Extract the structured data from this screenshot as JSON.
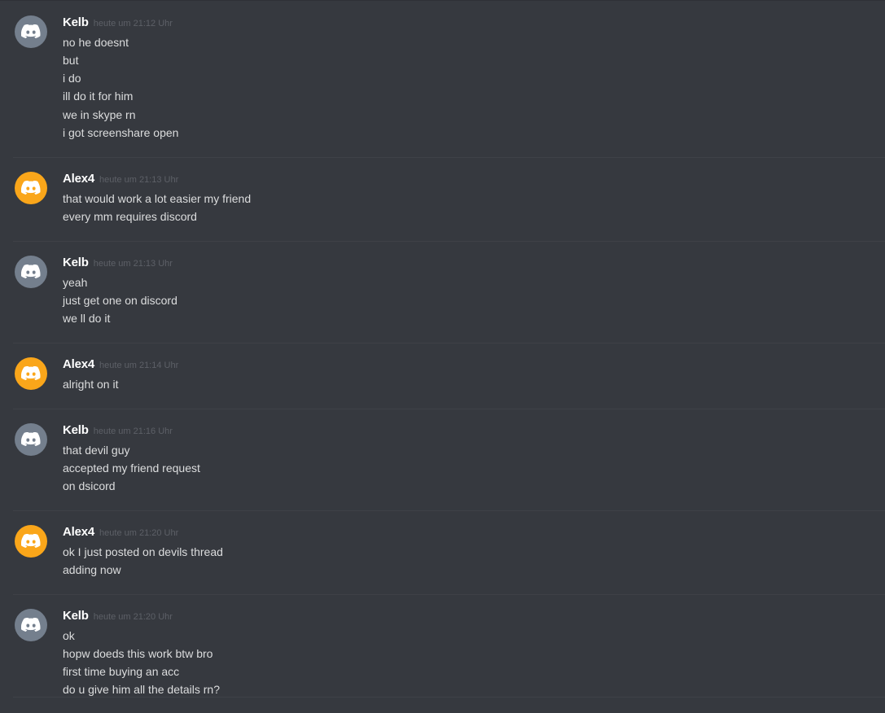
{
  "colors": {
    "background": "#36393f",
    "avatar_gray": "#747f8d",
    "avatar_orange": "#faa61a",
    "username": "#ffffff",
    "timestamp": "#5d6067",
    "message_text": "#dcddde"
  },
  "messages": [
    {
      "author": "Kelb",
      "avatar_icon": "discord-logo-icon",
      "avatar_color": "#747f8d",
      "timestamp": "heute um 21:12 Uhr",
      "lines": [
        "no he doesnt",
        "but",
        "i do",
        "ill do it for him",
        "we in skype rn",
        "i got screenshare open"
      ]
    },
    {
      "author": "Alex4",
      "avatar_icon": "discord-logo-icon",
      "avatar_color": "#faa61a",
      "timestamp": "heute um 21:13 Uhr",
      "lines": [
        "that would work a lot easier my friend",
        "every mm requires discord"
      ]
    },
    {
      "author": "Kelb",
      "avatar_icon": "discord-logo-icon",
      "avatar_color": "#747f8d",
      "timestamp": "heute um 21:13 Uhr",
      "lines": [
        "yeah",
        "just get one on discord",
        "we ll do it"
      ]
    },
    {
      "author": "Alex4",
      "avatar_icon": "discord-logo-icon",
      "avatar_color": "#faa61a",
      "timestamp": "heute um 21:14 Uhr",
      "lines": [
        "alright on it"
      ]
    },
    {
      "author": "Kelb",
      "avatar_icon": "discord-logo-icon",
      "avatar_color": "#747f8d",
      "timestamp": "heute um 21:16 Uhr",
      "lines": [
        "that devil guy",
        "accepted my friend request",
        "on dsicord"
      ]
    },
    {
      "author": "Alex4",
      "avatar_icon": "discord-logo-icon",
      "avatar_color": "#faa61a",
      "timestamp": "heute um 21:20 Uhr",
      "lines": [
        "ok I just posted on devils thread",
        "adding now"
      ]
    },
    {
      "author": "Kelb",
      "avatar_icon": "discord-logo-icon",
      "avatar_color": "#747f8d",
      "timestamp": "heute um 21:20 Uhr",
      "lines": [
        "ok",
        "hopw doeds this work btw bro",
        "first time buying an acc",
        "do u give him all the details rn?"
      ]
    }
  ]
}
